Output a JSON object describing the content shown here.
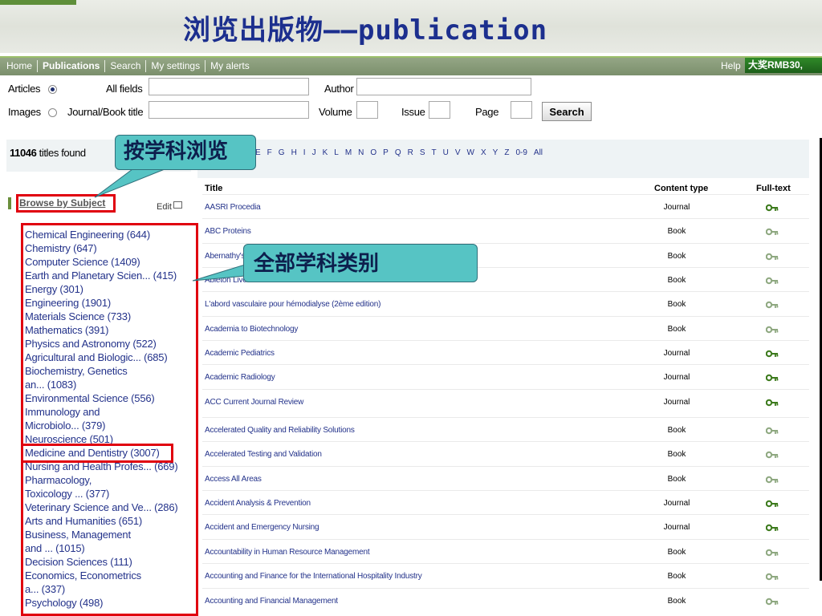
{
  "slide": {
    "title": "浏览出版物——publication"
  },
  "nav": {
    "items": [
      "Home",
      "Publications",
      "Search",
      "My settings",
      "My alerts"
    ],
    "active": 1,
    "help": "Help",
    "promo": "大奖RMB30,"
  },
  "search": {
    "articles_label": "Articles",
    "images_label": "Images",
    "all_fields_label": "All fields",
    "journal_label": "Journal/Book title",
    "author_label": "Author",
    "volume_label": "Volume",
    "issue_label": "Issue",
    "page_label": "Page",
    "button": "Search"
  },
  "results": {
    "count": "11046",
    "count_suffix": " titles found",
    "alphabet": [
      "E",
      "F",
      "G",
      "H",
      "I",
      "J",
      "K",
      "L",
      "M",
      "N",
      "O",
      "P",
      "Q",
      "R",
      "S",
      "T",
      "U",
      "V",
      "W",
      "X",
      "Y",
      "Z",
      "0-9",
      "All"
    ]
  },
  "sidebar": {
    "heading": "Browse by Subject",
    "edit": "Edit",
    "subjects": [
      "Chemical Engineering (644)",
      "Chemistry (647)",
      "Computer Science (1409)",
      "Earth and Planetary Scien... (415)",
      "Energy (301)",
      "Engineering (1901)",
      "Materials Science (733)",
      "Mathematics (391)",
      "Physics and Astronomy (522)",
      "Agricultural and Biologic... (685)",
      "Biochemistry, Genetics",
      "an... (1083)",
      "Environmental Science (556)",
      "Immunology and",
      "Microbiolo... (379)",
      "Neuroscience (501)",
      "Medicine and Dentistry (3007)",
      "Nursing and Health Profes... (669)",
      "Pharmacology,",
      "Toxicology ... (377)",
      "Veterinary Science and Ve... (286)",
      "Arts and Humanities (651)",
      "Business, Management",
      "and ... (1015)",
      "Decision Sciences (111)",
      "Economics, Econometrics",
      "a... (337)",
      "Psychology (498)"
    ]
  },
  "table": {
    "headers": {
      "title": "Title",
      "content_type": "Content type",
      "full_text": "Full-text"
    },
    "rows": [
      {
        "title": "AASRI Procedia",
        "type": "Journal",
        "full_text": true
      },
      {
        "title": "ABC Proteins",
        "type": "Book",
        "full_text": false
      },
      {
        "title": "Abernathy's",
        "type": "Book",
        "full_text": false
      },
      {
        "title": "Ableton Live",
        "type": "Book",
        "full_text": false
      },
      {
        "title": "L'abord vasculaire pour hémodialyse (2ème edition)",
        "type": "Book",
        "full_text": false
      },
      {
        "title": "Academia to Biotechnology",
        "type": "Book",
        "full_text": false
      },
      {
        "title": "Academic Pediatrics",
        "type": "Journal",
        "full_text": true
      },
      {
        "title": "Academic Radiology",
        "type": "Journal",
        "full_text": true
      },
      {
        "title": "ACC Current Journal Review",
        "type": "Journal",
        "full_text": true
      },
      {
        "title": "Accelerated Quality and Reliability Solutions",
        "type": "Book",
        "full_text": false
      },
      {
        "title": "Accelerated Testing and Validation",
        "type": "Book",
        "full_text": false
      },
      {
        "title": "Access All Areas",
        "type": "Book",
        "full_text": false
      },
      {
        "title": "Accident Analysis & Prevention",
        "type": "Journal",
        "full_text": true
      },
      {
        "title": "Accident and Emergency Nursing",
        "type": "Journal",
        "full_text": true
      },
      {
        "title": "Accountability in Human Resource Management",
        "type": "Book",
        "full_text": false
      },
      {
        "title": "Accounting and Finance for the International Hospitality Industry",
        "type": "Book",
        "full_text": false
      },
      {
        "title": "Accounting and Financial Management",
        "type": "Book",
        "full_text": false
      }
    ]
  },
  "annotations": {
    "browse_callout": "按学科浏览",
    "all_subjects_callout": "全部学科类别"
  },
  "colors": {
    "title_blue": "#1c2f8e",
    "link_blue": "#23328a",
    "nav_green": "#7b8f6c",
    "annotation_red": "#e0000f",
    "callout_teal": "#56c4c4",
    "key_active": "#3c7a1c",
    "key_inactive": "#8ea880"
  }
}
